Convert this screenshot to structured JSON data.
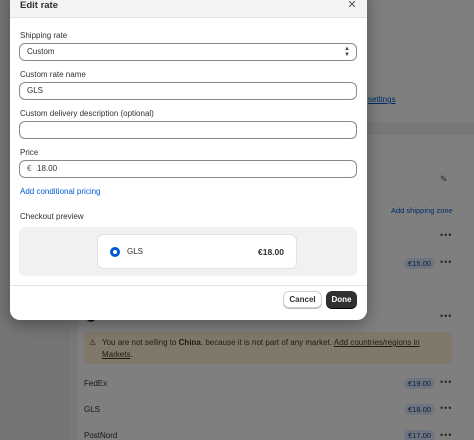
{
  "modal": {
    "title": "Edit rate",
    "close_icon": "close-icon",
    "shipping_rate": {
      "label": "Shipping rate",
      "value": "Custom"
    },
    "custom_rate_name": {
      "label": "Custom rate name",
      "value": "GLS"
    },
    "delivery_description": {
      "label": "Custom delivery description (optional)",
      "value": ""
    },
    "price": {
      "label": "Price",
      "currency_symbol": "€",
      "value": "18.00"
    },
    "add_conditional_pricing": "Add conditional pricing",
    "checkout_preview": {
      "label": "Checkout preview",
      "option_name": "GLS",
      "option_price": "€18.00"
    },
    "buttons": {
      "cancel": "Cancel",
      "done": "Done"
    }
  },
  "background": {
    "settings_link": "settings",
    "add_shipping_zone": "Add shipping zone",
    "warning": {
      "text_before": "You are not selling to ",
      "country": "China",
      "text_after": ", because it is not part of any market. ",
      "link": "Add countries/regions in Markets",
      "end": "."
    },
    "rates": [
      {
        "name": "FedEx",
        "price": "€19.00"
      },
      {
        "name": "GLS",
        "price": "€18.00"
      },
      {
        "name": "PostNord",
        "price": "€17.00"
      }
    ],
    "other_price": "€15.00"
  },
  "colors": {
    "accent": "#005bd3",
    "primary_button": "#303030",
    "price_badge": "#dce8ff",
    "warning_bg": "#fff0d6"
  }
}
